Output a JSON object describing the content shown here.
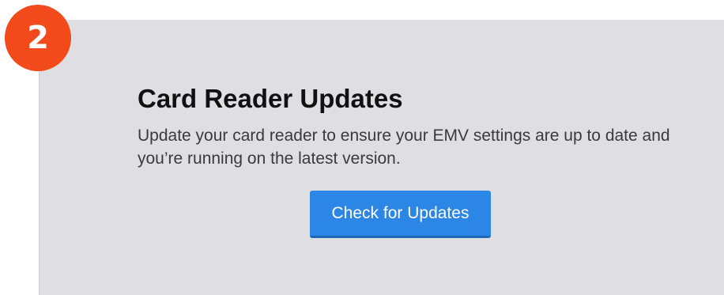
{
  "step": {
    "number": "2",
    "color": "#f24a1a"
  },
  "card": {
    "title": "Card Reader Updates",
    "description": "Update your card reader to ensure your EMV settings are up to date and you’re running on the latest version.",
    "button_label": "Check for Updates",
    "button_color": "#2b86e6",
    "background": "#dfdfe3"
  }
}
